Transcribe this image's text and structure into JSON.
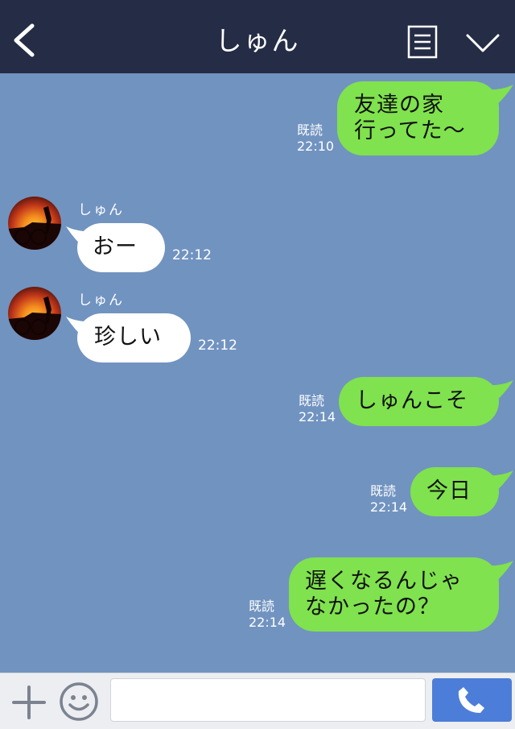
{
  "header": {
    "title": "しゅん",
    "back_icon": "chevron-left-icon",
    "menu_icon": "note-list-icon",
    "collapse_icon": "chevron-down-icon"
  },
  "messages": [
    {
      "direction": "out",
      "lines": [
        "友達の家",
        "行ってた〜"
      ],
      "read_label": "既読",
      "time": "22:10"
    },
    {
      "direction": "in",
      "sender": "しゅん",
      "lines": [
        "おー"
      ],
      "time": "22:12"
    },
    {
      "direction": "in",
      "sender": "しゅん",
      "lines": [
        "珍しい"
      ],
      "time": "22:12"
    },
    {
      "direction": "out",
      "lines": [
        "しゅんこそ"
      ],
      "read_label": "既読",
      "time": "22:14"
    },
    {
      "direction": "out",
      "lines": [
        "今日"
      ],
      "read_label": "既読",
      "time": "22:14"
    },
    {
      "direction": "out",
      "lines": [
        "遅くなるんじゃ",
        "なかったの？"
      ],
      "read_label": "既読",
      "time": "22:14"
    }
  ],
  "input_bar": {
    "message_value": "",
    "plus_icon": "plus-icon",
    "emoji_icon": "smiley-icon",
    "call_icon": "phone-icon"
  },
  "colors": {
    "header_bg": "#242d45",
    "chat_bg": "#7193c0",
    "outgoing_bubble": "#80e24e",
    "incoming_bubble": "#ffffff",
    "call_button": "#4c7ed9"
  }
}
